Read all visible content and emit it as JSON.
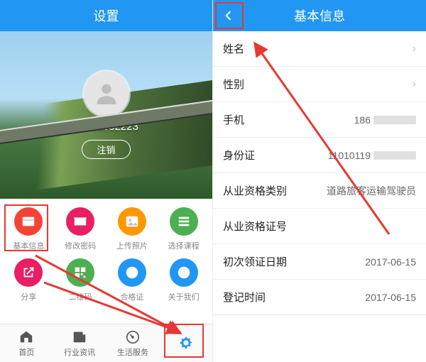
{
  "left": {
    "title": "设置",
    "phone": "18611632223",
    "logout": "注销",
    "grid": [
      {
        "label": "基本信息",
        "color": "#f44336",
        "icon": "card"
      },
      {
        "label": "修改密码",
        "color": "#e91e63",
        "icon": "mail"
      },
      {
        "label": "上传照片",
        "color": "#ff9800",
        "icon": "image"
      },
      {
        "label": "选择课程",
        "color": "#4caf50",
        "icon": "list"
      },
      {
        "label": "分享",
        "color": "#e91e63",
        "icon": "share"
      },
      {
        "label": "二维码",
        "color": "#4caf50",
        "icon": "qr"
      },
      {
        "label": "合格证",
        "color": "#2196f3",
        "icon": "check"
      },
      {
        "label": "关于我们",
        "color": "#2196f3",
        "icon": "info"
      }
    ],
    "tabs": [
      {
        "label": "首页",
        "icon": "home"
      },
      {
        "label": "行业资讯",
        "icon": "news"
      },
      {
        "label": "生活服务",
        "icon": "dash"
      },
      {
        "label": "",
        "icon": "gear",
        "active": true
      }
    ]
  },
  "right": {
    "title": "基本信息",
    "rows": [
      {
        "label": "姓名",
        "value": "",
        "chevron": true
      },
      {
        "label": "性别",
        "value": "",
        "chevron": true
      },
      {
        "label": "手机",
        "value": "186",
        "censored": true
      },
      {
        "label": "身份证",
        "value": "11010119",
        "censored": true
      },
      {
        "label": "从业资格类别",
        "value": "道路旅客运输驾驶员"
      },
      {
        "label": "从业资格证号",
        "value": ""
      },
      {
        "label": "初次领证日期",
        "value": "2017-06-15"
      },
      {
        "label": "登记时间",
        "value": "2017-06-15"
      }
    ]
  }
}
